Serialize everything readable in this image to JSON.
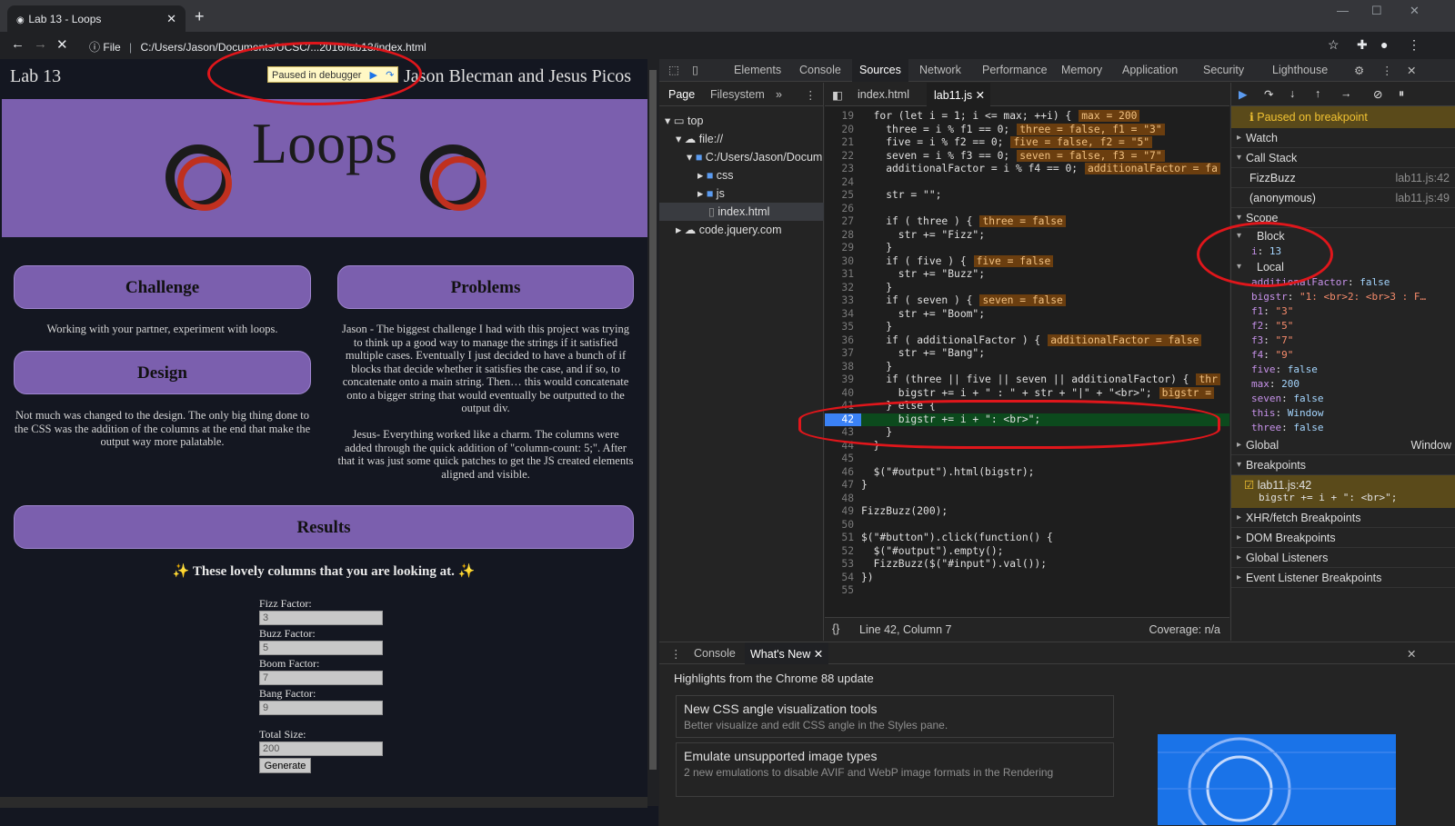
{
  "browser": {
    "tab_title": "Lab 13 - Loops",
    "address_prefix": "File",
    "address_url": "C:/Users/Jason/Documents/UCSC/...2016/lab13/index.html"
  },
  "page": {
    "header_title": "Lab 13",
    "header_authors": "Jason Blecman and Jesus Picos",
    "paused_label": "Paused in debugger",
    "banner_title": "Loops",
    "cards": {
      "challenge": "Challenge",
      "problems": "Problems",
      "design": "Design",
      "results": "Results"
    },
    "challenge_text": "Working with your partner, experiment with loops.",
    "design_text": "Not much was changed to the design. The only big thing done to the CSS was the addition of the columns at the end that make the output way more palatable.",
    "problems_text_1": "Jason - The biggest challenge I had with this project was trying to think up a good way to manage the strings if it satisfied multiple cases. Eventually I just decided to have a bunch of if blocks that decide whether it satisfies the case, and if so, to concatenate onto a main string. Then… this would concatenate onto a bigger string that would eventually be outputted to the output div.",
    "problems_text_2": "Jesus- Everything worked like a charm. The columns were added through the quick addition of \"column-count: 5;\". After that it was just some quick patches to get the JS created elements aligned and visible.",
    "results_caption": "✨ These lovely columns that you are looking at. ✨",
    "form": {
      "fizz_label": "Fizz Factor:",
      "fizz_value": "3",
      "buzz_label": "Buzz Factor:",
      "buzz_value": "5",
      "boom_label": "Boom Factor:",
      "boom_value": "7",
      "bang_label": "Bang Factor:",
      "bang_value": "9",
      "size_label": "Total Size:",
      "size_value": "200",
      "generate_label": "Generate"
    }
  },
  "devtools": {
    "tabs": [
      "Elements",
      "Console",
      "Sources",
      "Network",
      "Performance",
      "Memory",
      "Application",
      "Security",
      "Lighthouse"
    ],
    "active_tab": "Sources",
    "navigator_tabs": [
      "Page",
      "Filesystem"
    ],
    "tree": {
      "top": "top",
      "file": "file://",
      "folder": "C:/Users/Jason/Docum",
      "css": "css",
      "js": "js",
      "index": "index.html",
      "jquery": "code.jquery.com"
    },
    "editor_tabs": [
      "index.html",
      "lab11.js"
    ],
    "status_position": "Line 42, Column 7",
    "status_coverage": "Coverage: n/a",
    "code_lines": [
      {
        "n": "19",
        "code": "  for (let i = 1; i <= max; ++i) {",
        "inline": "max = 200"
      },
      {
        "n": "20",
        "code": "    three = i % f1 == 0;",
        "inline": "three = false, f1 = \"3\""
      },
      {
        "n": "21",
        "code": "    five = i % f2 == 0;",
        "inline": "five = false, f2 = \"5\""
      },
      {
        "n": "22",
        "code": "    seven = i % f3 == 0;",
        "inline": "seven = false, f3 = \"7\""
      },
      {
        "n": "23",
        "code": "    additionalFactor = i % f4 == 0;",
        "inline": "additionalFactor = fa"
      },
      {
        "n": "24",
        "code": "",
        "inline": ""
      },
      {
        "n": "25",
        "code": "    str = \"\";",
        "inline": ""
      },
      {
        "n": "26",
        "code": "",
        "inline": ""
      },
      {
        "n": "27",
        "code": "    if ( three ) {",
        "inline": "three = false"
      },
      {
        "n": "28",
        "code": "      str += \"Fizz\";",
        "inline": ""
      },
      {
        "n": "29",
        "code": "    }",
        "inline": ""
      },
      {
        "n": "30",
        "code": "    if ( five ) {",
        "inline": "five = false"
      },
      {
        "n": "31",
        "code": "      str += \"Buzz\";",
        "inline": ""
      },
      {
        "n": "32",
        "code": "    }",
        "inline": ""
      },
      {
        "n": "33",
        "code": "    if ( seven ) {",
        "inline": "seven = false"
      },
      {
        "n": "34",
        "code": "      str += \"Boom\";",
        "inline": ""
      },
      {
        "n": "35",
        "code": "    }",
        "inline": ""
      },
      {
        "n": "36",
        "code": "    if ( additionalFactor ) {",
        "inline": "additionalFactor = false"
      },
      {
        "n": "37",
        "code": "      str += \"Bang\";",
        "inline": ""
      },
      {
        "n": "38",
        "code": "    }",
        "inline": ""
      },
      {
        "n": "39",
        "code": "    if (three || five || seven || additionalFactor) {",
        "inline": "thr"
      },
      {
        "n": "40",
        "code": "      bigstr += i + \" : \" + str + \"|\" + \"<br>\";",
        "inline": "bigstr ="
      },
      {
        "n": "41",
        "code": "    } else {",
        "inline": ""
      },
      {
        "n": "42",
        "code": "      bigstr += i + \": <br>\";",
        "inline": ""
      },
      {
        "n": "43",
        "code": "    }",
        "inline": ""
      },
      {
        "n": "44",
        "code": "  }",
        "inline": ""
      },
      {
        "n": "45",
        "code": "",
        "inline": ""
      },
      {
        "n": "46",
        "code": "  $(\"#output\").html(bigstr);",
        "inline": ""
      },
      {
        "n": "47",
        "code": "}",
        "inline": ""
      },
      {
        "n": "48",
        "code": "",
        "inline": ""
      },
      {
        "n": "49",
        "code": "FizzBuzz(200);",
        "inline": ""
      },
      {
        "n": "50",
        "code": "",
        "inline": ""
      },
      {
        "n": "51",
        "code": "$(\"#button\").click(function() {",
        "inline": ""
      },
      {
        "n": "52",
        "code": "  $(\"#output\").empty();",
        "inline": ""
      },
      {
        "n": "53",
        "code": "  FizzBuzz($(\"#input\").val());",
        "inline": ""
      },
      {
        "n": "54",
        "code": "})",
        "inline": ""
      },
      {
        "n": "55",
        "code": "",
        "inline": ""
      }
    ],
    "current_line": "42",
    "paused_banner": "Paused on breakpoint",
    "sections": {
      "watch": "Watch",
      "call_stack": "Call Stack",
      "scope": "Scope",
      "block": "Block",
      "local": "Local",
      "global": "Global",
      "global_value": "Window",
      "breakpoints": "Breakpoints",
      "xhr": "XHR/fetch Breakpoints",
      "dom": "DOM Breakpoints",
      "global_listeners": "Global Listeners",
      "event_listeners": "Event Listener Breakpoints"
    },
    "call_stack": [
      {
        "fn": "FizzBuzz",
        "loc": "lab11.js:42"
      },
      {
        "fn": "(anonymous)",
        "loc": "lab11.js:49"
      }
    ],
    "block_vars": [
      {
        "k": "i",
        "v": "13"
      }
    ],
    "local_vars": [
      {
        "k": "additionalFactor",
        "v": "false"
      },
      {
        "k": "bigstr",
        "v": "\"1: <br>2: <br>3 : F…"
      },
      {
        "k": "f1",
        "v": "\"3\""
      },
      {
        "k": "f2",
        "v": "\"5\""
      },
      {
        "k": "f3",
        "v": "\"7\""
      },
      {
        "k": "f4",
        "v": "\"9\""
      },
      {
        "k": "five",
        "v": "false"
      },
      {
        "k": "max",
        "v": "200"
      },
      {
        "k": "seven",
        "v": "false"
      },
      {
        "k": "this",
        "v": "Window"
      },
      {
        "k": "three",
        "v": "false"
      }
    ],
    "breakpoint_file": "lab11.js:42",
    "breakpoint_code": "bigstr += i + \": <br>\";",
    "drawer_tabs": [
      "Console",
      "What's New"
    ],
    "drawer_heading": "Highlights from the Chrome 88 update",
    "news": [
      {
        "title": "New CSS angle visualization tools",
        "desc": "Better visualize and edit CSS angle in the Styles pane."
      },
      {
        "title": "Emulate unsupported image types",
        "desc": "2 new emulations to disable AVIF and WebP image formats in the Rendering"
      }
    ]
  }
}
